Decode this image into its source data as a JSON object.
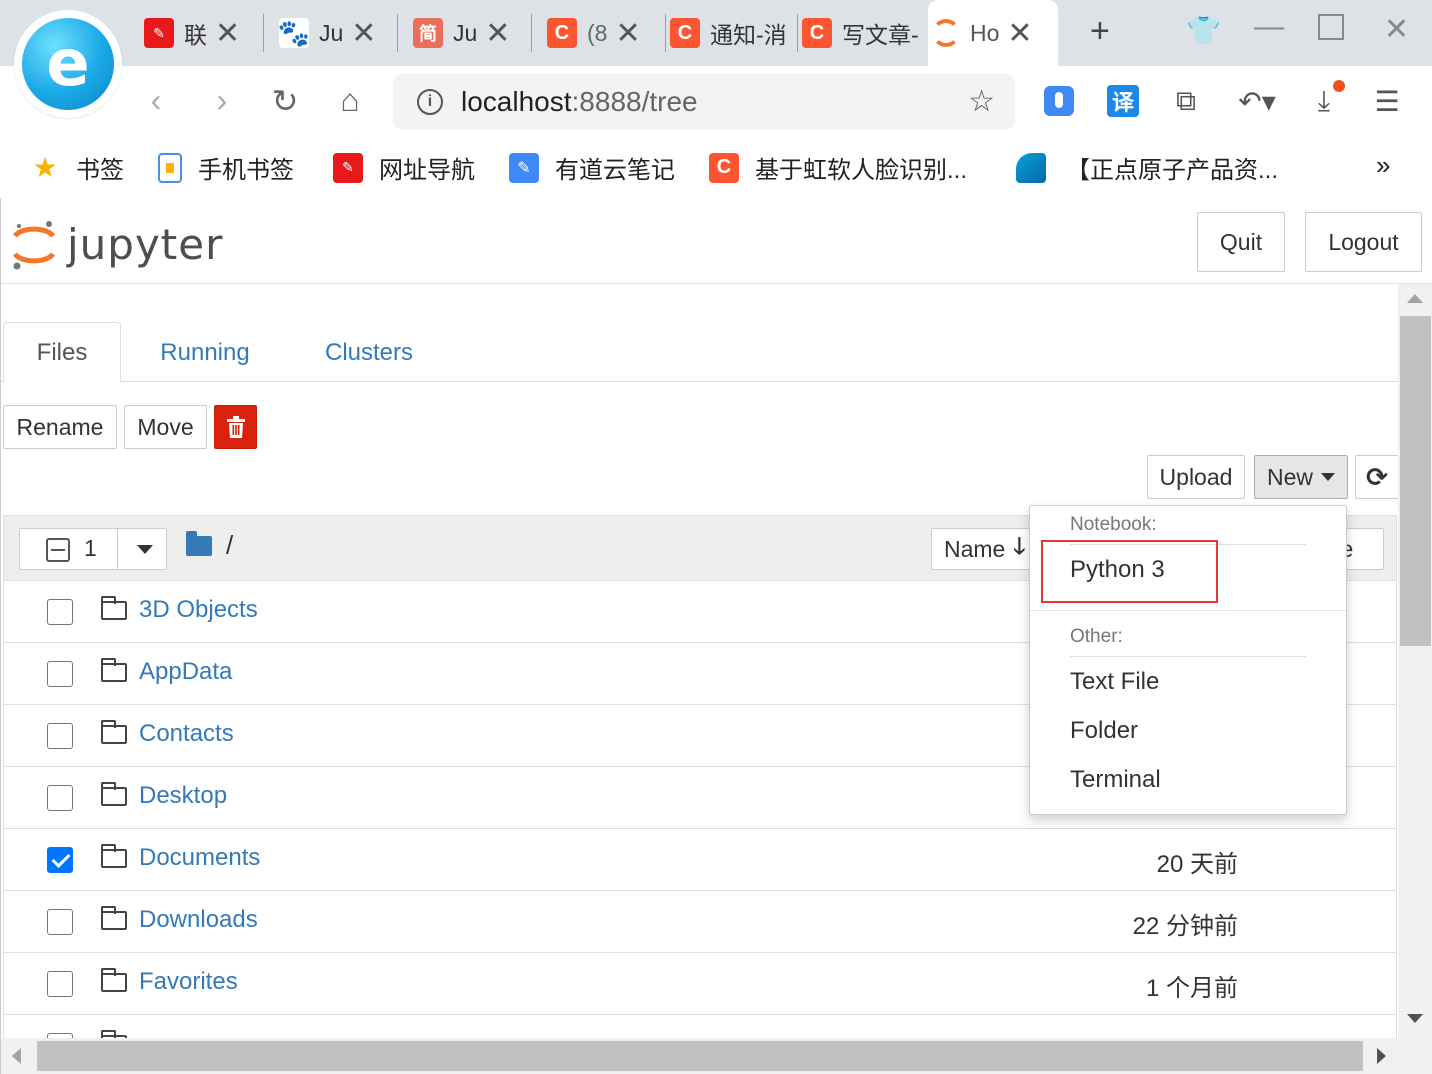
{
  "browser": {
    "tabs": [
      {
        "title": "联",
        "favicon": "xinpai-icon",
        "color": "#e8191a"
      },
      {
        "title": "Ju",
        "favicon": "baidu-paw-icon",
        "color": "#2932e1"
      },
      {
        "title": "Ju",
        "favicon": "jianshu-icon",
        "color": "#ea6f5a"
      },
      {
        "title": "(8",
        "favicon": "csdn-icon",
        "color": "#fc5531"
      },
      {
        "title": "通知-消",
        "favicon": "csdn-icon",
        "color": "#fc5531"
      },
      {
        "title": "写文章-",
        "favicon": "csdn-icon",
        "color": "#fc5531"
      },
      {
        "title": "Ho",
        "favicon": "jupyter-icon",
        "color": "#f37726"
      }
    ],
    "address": {
      "host": "localhost",
      "rest": ":8888/tree"
    },
    "bookmarks": [
      {
        "label": "书签",
        "icon": "star-icon"
      },
      {
        "label": "手机书签",
        "icon": "phone-icon"
      },
      {
        "label": "网址导航",
        "icon": "xinpai-icon"
      },
      {
        "label": "有道云笔记",
        "icon": "youdao-note-icon"
      },
      {
        "label": "基于虹软人脸识别...",
        "icon": "csdn-icon"
      },
      {
        "label": "【正点原子产品资...",
        "icon": "cloud-drive-icon"
      }
    ],
    "more_bookmarks": "»",
    "translate_ext": "译"
  },
  "jupyter": {
    "logo_text": "jupyter",
    "quit_label": "Quit",
    "logout_label": "Logout",
    "tabs": [
      "Files",
      "Running",
      "Clusters"
    ],
    "rename_label": "Rename",
    "move_label": "Move",
    "upload_label": "Upload",
    "new_label": "New",
    "selected_count": "1",
    "breadcrumb_path": "/",
    "sort_name_label": "Name",
    "sort_size_label": "ze",
    "files": [
      {
        "name": "3D Objects",
        "modified": "",
        "checked": false
      },
      {
        "name": "AppData",
        "modified": "",
        "checked": false
      },
      {
        "name": "Contacts",
        "modified": "",
        "checked": false
      },
      {
        "name": "Desktop",
        "modified": "",
        "checked": false
      },
      {
        "name": "Documents",
        "modified": "20 天前",
        "checked": true
      },
      {
        "name": "Downloads",
        "modified": "22 分钟前",
        "checked": false
      },
      {
        "name": "Favorites",
        "modified": "1 个月前",
        "checked": false
      }
    ],
    "new_menu": {
      "notebook_header": "Notebook:",
      "python_label": "Python 3",
      "other_header": "Other:",
      "items": [
        "Text File",
        "Folder",
        "Terminal"
      ]
    }
  },
  "colors": {
    "link": "#337ab7",
    "danger": "#d9230f",
    "highlight": "#e53935",
    "checkbox": "#0075ff"
  }
}
